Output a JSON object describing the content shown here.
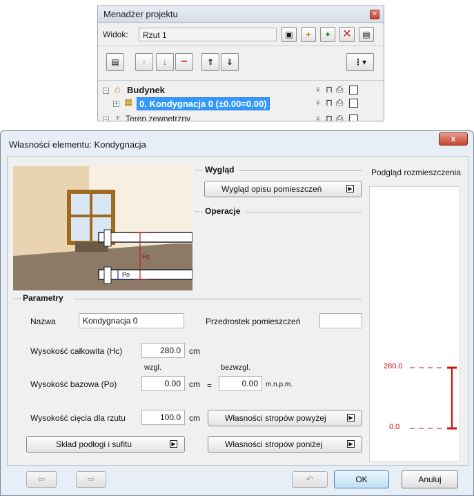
{
  "project_manager": {
    "title": "Menadżer projektu",
    "view_label": "Widok:",
    "view_value": "Rzut 1",
    "tree": {
      "building": "Budynek",
      "selected_level": "0. Kondygnacja 0 (±0.00=0.00)",
      "external_area": "Teren zewnętrzny"
    }
  },
  "dialog": {
    "title": "Własności elementu: Kondygnacja",
    "close_glyph": "x",
    "appearance": {
      "header": "Wygląd",
      "room_label_button": "Wygląd opisu pomieszczeń"
    },
    "operations": {
      "header": "Operacje"
    },
    "preview": {
      "title": "Podgląd rozmieszczenia",
      "top_value": "280.0",
      "bottom_value": "0.0",
      "line_color": "#d20f0f"
    },
    "illustration": {
      "hc_label": "Hc",
      "po_label": "Po"
    },
    "parameters": {
      "header": "Parametry",
      "name_label": "Nazwa",
      "name_value": "Kondygnacja 0",
      "room_prefix_label": "Przedrostek pomieszczeń",
      "room_prefix_value": "",
      "total_height_label": "Wysokość całkowita (Hc)",
      "total_height_value": "280.0",
      "total_height_unit": "cm",
      "relative_label": "wzgl.",
      "absolute_label": "bezwzgl.",
      "base_height_label": "Wysokość bazowa (Po)",
      "base_height_value": "0.00",
      "base_height_unit": "cm",
      "equals": "=",
      "absolute_value": "0.00",
      "absolute_unit": "m.n.p.m.",
      "cut_height_label": "Wysokość cięcia dla rzutu",
      "cut_height_value": "100.0",
      "cut_height_unit": "cm",
      "ceilings_above_button": "Własności stropów powyżej",
      "ceilings_below_button": "Własności stropów poniżej",
      "floor_ceiling_button": "Skład podłogi i sufitu"
    },
    "footer": {
      "ok_label": "OK",
      "cancel_label": "Anuluj"
    }
  }
}
